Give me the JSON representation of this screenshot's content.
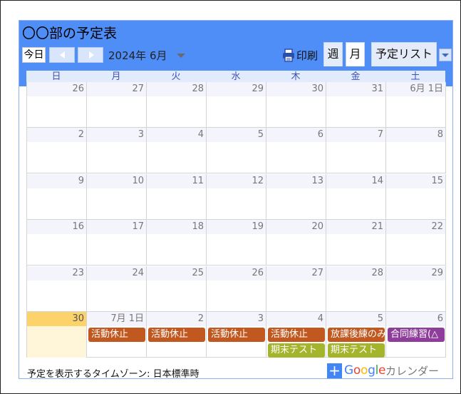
{
  "title": "〇〇部の予定表",
  "toolbar": {
    "today_label": "今日",
    "current_month": "2024年 6月",
    "print_label": "印刷",
    "tabs": [
      {
        "label": "週",
        "active": false
      },
      {
        "label": "月",
        "active": true
      },
      {
        "label": "予定リスト",
        "active": false
      }
    ],
    "icons": {
      "prev": "chevron-left-icon",
      "next": "chevron-right-icon",
      "print": "printer-icon",
      "dropdown": "chevron-down-icon"
    }
  },
  "weekdays": [
    "日",
    "月",
    "火",
    "水",
    "木",
    "金",
    "土"
  ],
  "weeks": [
    [
      "26",
      "27",
      "28",
      "29",
      "30",
      "31",
      "6月 1日"
    ],
    [
      "2",
      "3",
      "4",
      "5",
      "6",
      "7",
      "8"
    ],
    [
      "9",
      "10",
      "11",
      "12",
      "13",
      "14",
      "15"
    ],
    [
      "16",
      "17",
      "18",
      "19",
      "20",
      "21",
      "22"
    ],
    [
      "23",
      "24",
      "25",
      "26",
      "27",
      "28",
      "29"
    ],
    [
      "30",
      "7月 1日",
      "2",
      "3",
      "4",
      "5",
      "6"
    ]
  ],
  "today": {
    "week": 5,
    "day": 0
  },
  "events": [
    {
      "title": "活動休止",
      "week": 5,
      "day": 1,
      "lane": 0,
      "color": "#c1581f"
    },
    {
      "title": "活動休止",
      "week": 5,
      "day": 2,
      "lane": 0,
      "color": "#c1581f"
    },
    {
      "title": "活動休止",
      "week": 5,
      "day": 3,
      "lane": 0,
      "color": "#c1581f"
    },
    {
      "title": "活動休止",
      "week": 5,
      "day": 4,
      "lane": 0,
      "color": "#c1581f"
    },
    {
      "title": "放課後練のみ",
      "week": 5,
      "day": 5,
      "lane": 0,
      "color": "#c1581f"
    },
    {
      "title": "合同練習(△",
      "week": 5,
      "day": 6,
      "lane": 0,
      "color": "#8e3e9a"
    },
    {
      "title": "期末テスト",
      "week": 5,
      "day": 4,
      "lane": 1,
      "color": "#a4b42d"
    },
    {
      "title": "期末テスト",
      "week": 5,
      "day": 5,
      "lane": 1,
      "color": "#a4b42d"
    }
  ],
  "footer": {
    "timezone": "予定を表示するタイムゾーン: 日本標準時",
    "google_calendar_label": "カレンダー",
    "google_wordmark": "Google"
  },
  "colors": {
    "header_bg": "#4f8ef7",
    "today_highlight": "#fcd36b",
    "weekday_text": "#3f51b5"
  }
}
